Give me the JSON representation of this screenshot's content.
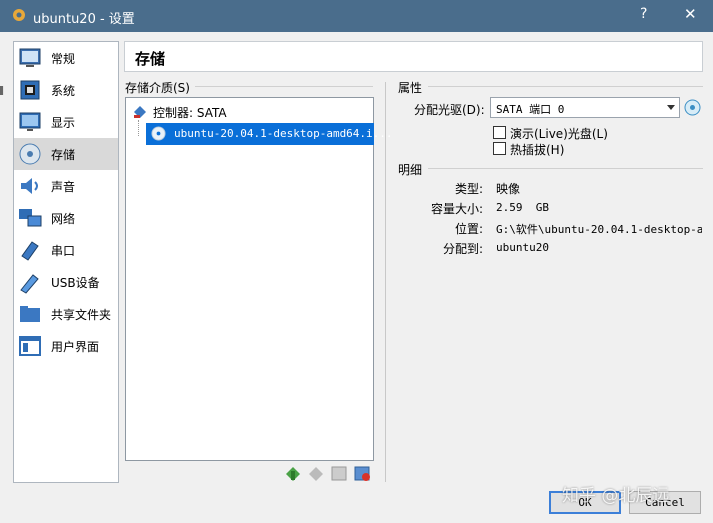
{
  "window": {
    "title": "ubuntu20 - 设置",
    "help_label": "?",
    "close_label": "✕"
  },
  "colors": {
    "titlebar": "#4a6d8c",
    "selection": "#0a6fd8",
    "accent": "#3c7fd8"
  },
  "sidebar": {
    "items": [
      {
        "label": "常规",
        "icon": "general-icon"
      },
      {
        "label": "系统",
        "icon": "system-icon"
      },
      {
        "label": "显示",
        "icon": "display-icon"
      },
      {
        "label": "存储",
        "icon": "storage-icon",
        "selected": true
      },
      {
        "label": "声音",
        "icon": "audio-icon"
      },
      {
        "label": "网络",
        "icon": "network-icon"
      },
      {
        "label": "串口",
        "icon": "serial-port-icon"
      },
      {
        "label": "USB设备",
        "icon": "usb-icon"
      },
      {
        "label": "共享文件夹",
        "icon": "shared-folder-icon"
      },
      {
        "label": "用户界面",
        "icon": "user-interface-icon"
      }
    ]
  },
  "page": {
    "title": "存储"
  },
  "storage": {
    "media_label": "存储介质(S)",
    "controller_label": "控制器: SATA",
    "disk_label": "ubuntu-20.04.1-desktop-amd64.i..."
  },
  "toolbar": {
    "icons": [
      "add-controller-icon",
      "remove-controller-icon",
      "add-attachment-icon",
      "remove-attachment-icon"
    ]
  },
  "attributes": {
    "heading": "属性",
    "drive_label": "分配光驱(D):",
    "drive_value": "SATA 端口 0",
    "live_cd_label": "演示(Live)光盘(L)",
    "live_cd_checked": false,
    "hotplug_label": "热插拔(H)",
    "hotplug_checked": false
  },
  "details": {
    "heading": "明细",
    "type_label": "类型:",
    "type_value": "映像",
    "size_label": "容量大小:",
    "size_value": "2.59  GB",
    "location_label": "位置:",
    "location_value": "G:\\软件\\ubuntu-20.04.1-desktop-a…",
    "attached_label": "分配到:",
    "attached_value": "ubuntu20"
  },
  "buttons": {
    "ok": "OK",
    "cancel": "Cancel"
  },
  "watermark": "知乎 @北辰远"
}
